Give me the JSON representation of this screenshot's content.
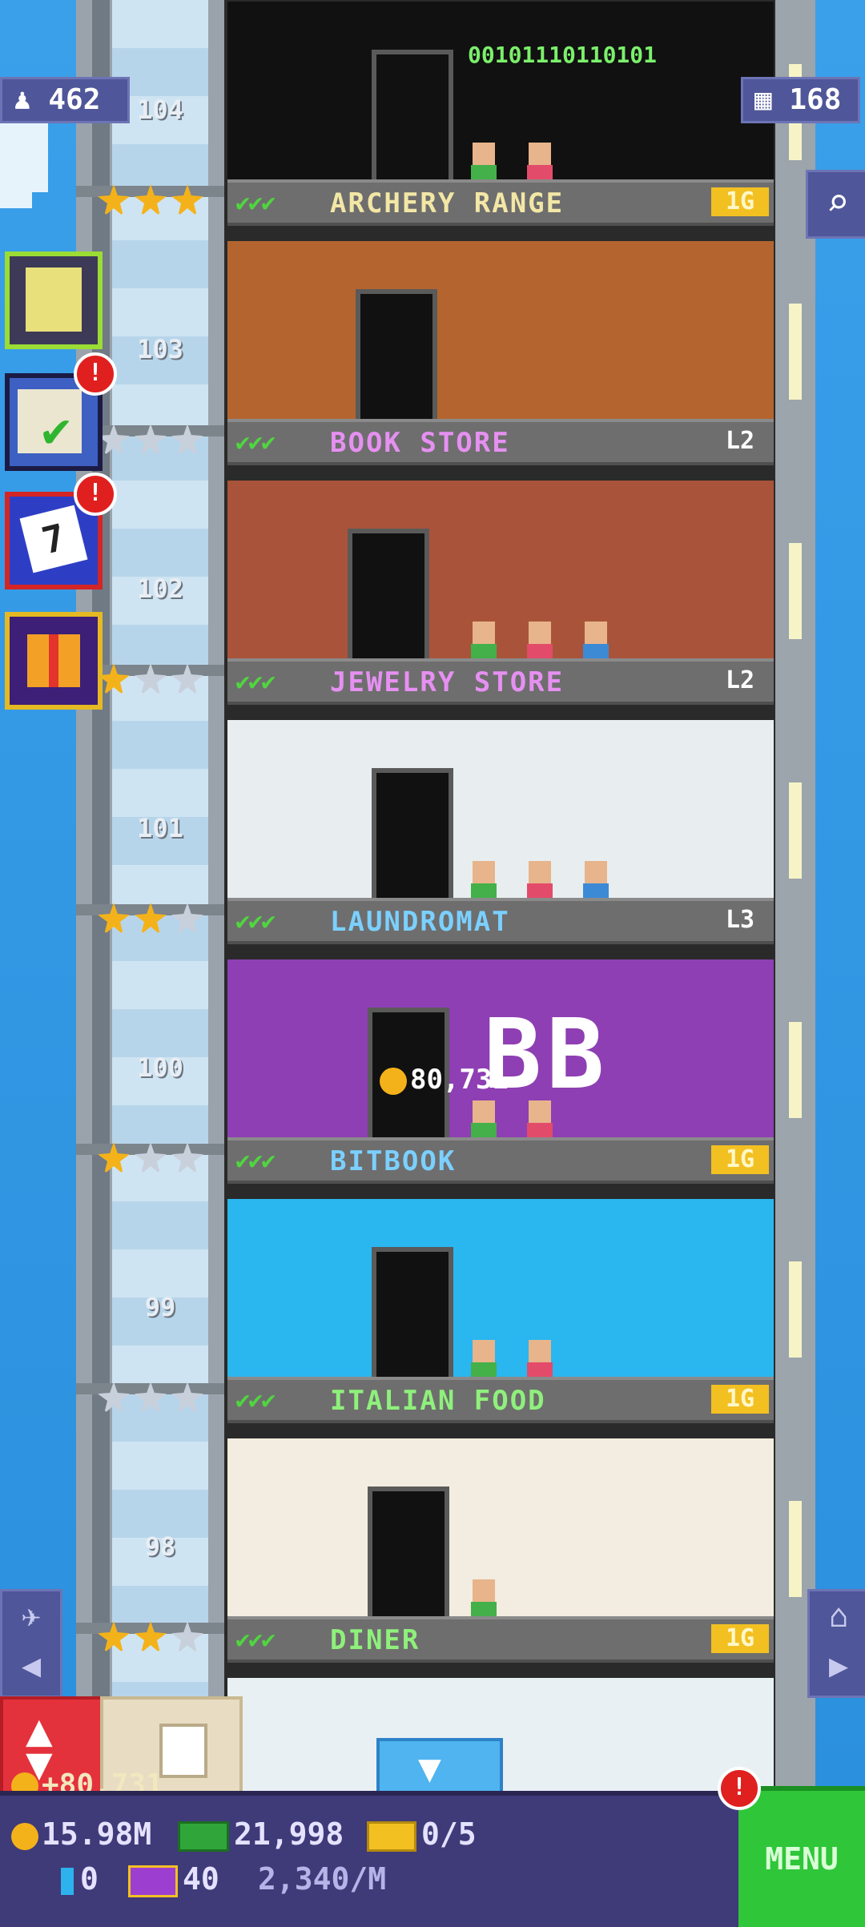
{
  "hud_top": {
    "population": "462",
    "floors": "168"
  },
  "floors": [
    {
      "number": "104",
      "name": "ARCHERY RANGE",
      "level": "1G",
      "stars": [
        1,
        1,
        1
      ],
      "name_color": "#f3e7a6",
      "binary_sign": "00101110110101"
    },
    {
      "number": "103",
      "name": "BOOK STORE",
      "level": "L2",
      "stars": [
        0,
        0,
        0
      ],
      "name_color": "#e690f2"
    },
    {
      "number": "102",
      "name": "JEWELRY STORE",
      "level": "L2",
      "stars": [
        1,
        0,
        0
      ],
      "name_color": "#e690f2"
    },
    {
      "number": "101",
      "name": "LAUNDROMAT",
      "level": "L3",
      "stars": [
        1,
        1,
        0
      ],
      "name_color": "#7bd0ff"
    },
    {
      "number": "100",
      "name": "BITBOOK",
      "level": "1G",
      "stars": [
        1,
        0,
        0
      ],
      "name_color": "#7bd0ff",
      "sign": "BB",
      "coin_popup": "80,731"
    },
    {
      "number": "99",
      "name": "ITALIAN FOOD",
      "level": "1G",
      "stars": [
        0,
        0,
        0
      ],
      "name_color": "#8ff07c"
    },
    {
      "number": "98",
      "name": "DINER",
      "level": "1G",
      "stars": [
        1,
        1,
        0
      ],
      "name_color": "#8ff07c"
    }
  ],
  "checks": "✔✔✔",
  "sidebar": {
    "missions_badge": "!",
    "calendar_badge": "!",
    "calendar_day": "7"
  },
  "bottom": {
    "coins": "15.98M",
    "bux": "21,998",
    "tickets": "0/5",
    "blue": "0",
    "vip": "40",
    "rate": "2,340/M",
    "income_popup": "+80,731",
    "menu_label": "MENU",
    "menu_badge": "!"
  },
  "colors": {
    "sky": "#2f8fd9",
    "gold": "#f4b21a",
    "menu": "#2fc63a",
    "hud": "#3f3a78"
  }
}
